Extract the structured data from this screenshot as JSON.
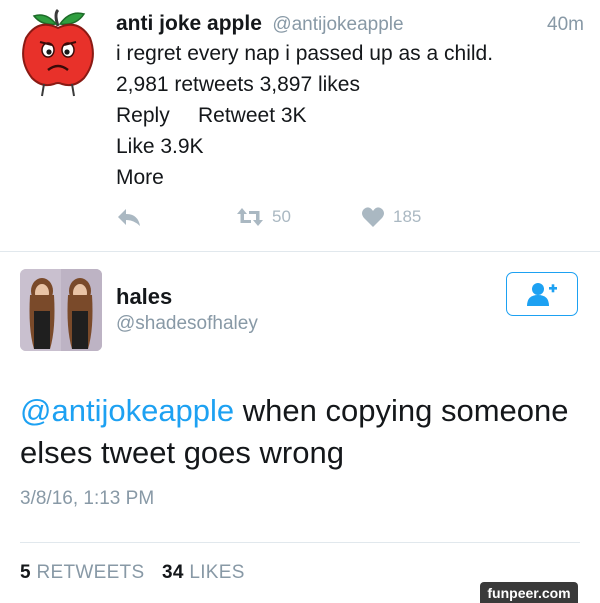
{
  "tweet1": {
    "author_name": "anti joke apple",
    "author_handle": "@antijokeapple",
    "time": "40m",
    "text": "i regret every nap i passed up as a child.",
    "stats_line": "2,981 retweets 3,897 likes",
    "reply_label": "Reply",
    "retweet_line": "Retweet  3K",
    "like_line": "Like 3.9K",
    "more_label": "More",
    "retweet_count": "50",
    "like_count": "185"
  },
  "tweet2": {
    "author_name": "hales",
    "author_handle": "@shadesofhaley",
    "mention": "@antijokeapple",
    "text_rest": " when copying someone elses tweet goes wrong",
    "date": "3/8/16, 1:13 PM",
    "retweets_count": "5",
    "retweets_label": "RETWEETS",
    "likes_count": "34",
    "likes_label": "LIKES"
  },
  "watermark": "funpeer.com",
  "colors": {
    "link_blue": "#1da1f2",
    "muted_gray": "#8899a6",
    "icon_gray": "#aab8c2",
    "apple_red": "#e8312a"
  }
}
